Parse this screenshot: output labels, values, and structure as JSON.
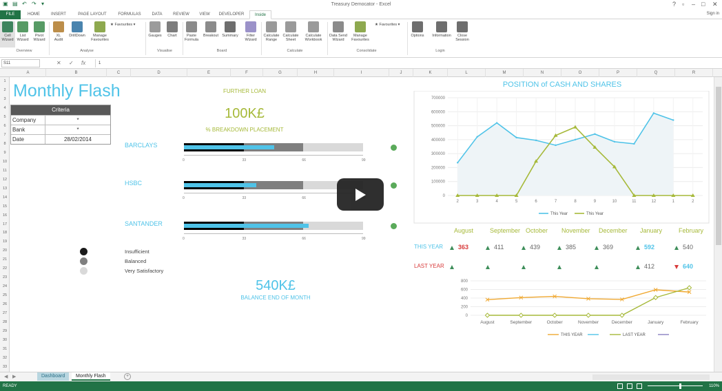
{
  "app": {
    "title": "Treasury Democator - Excel"
  },
  "tabs": [
    {
      "label": "FILE"
    },
    {
      "label": "HOME"
    },
    {
      "label": "INSERT"
    },
    {
      "label": "PAGE LAYOUT"
    },
    {
      "label": "FORMULAS"
    },
    {
      "label": "DATA"
    },
    {
      "label": "REVIEW"
    },
    {
      "label": "VIEW"
    },
    {
      "label": "DEVELOPER"
    },
    {
      "label": "Inside"
    }
  ],
  "signin": "Sign in",
  "ribbon": {
    "buttons": [
      {
        "label": "Cell\nWizard"
      },
      {
        "label": "List\nWizard"
      },
      {
        "label": "Pivot\nWizard"
      },
      {
        "label": "XL\nAudit"
      },
      {
        "label": "DrillDown"
      },
      {
        "label": "Manage\nFavourites"
      },
      {
        "label": "Gauges"
      },
      {
        "label": "Chart"
      },
      {
        "label": "Paste\nFormula"
      },
      {
        "label": "Breakout"
      },
      {
        "label": "Summary"
      },
      {
        "label": "Filter\nWizard"
      },
      {
        "label": "Calculate\nRange"
      },
      {
        "label": "Calculate\nSheet"
      },
      {
        "label": "Calculate\nWorkbook"
      },
      {
        "label": "Data Send\nWizard"
      },
      {
        "label": "Manage\nFavourites"
      },
      {
        "label": "Options"
      },
      {
        "label": "Information"
      },
      {
        "label": "Close\nSession"
      }
    ],
    "favourites_label": "Favourites",
    "groups": [
      "Overview",
      "Analyse",
      "Visualise",
      "Board",
      "Calculate",
      "Consolidate",
      "Login"
    ]
  },
  "formula_bar": {
    "name_box": "S11",
    "value": "1"
  },
  "columns": [
    "A",
    "B",
    "C",
    "D",
    "E",
    "F",
    "G",
    "H",
    "I",
    "J",
    "K",
    "L",
    "M",
    "N",
    "O",
    "P",
    "Q",
    "R"
  ],
  "rows": [
    "1",
    "2",
    "3",
    "4",
    "5",
    "6",
    "7",
    "8",
    "9",
    "10",
    "11",
    "12",
    "13",
    "14",
    "15",
    "16",
    "17",
    "18",
    "19",
    "20",
    "21",
    "22",
    "23",
    "24",
    "25",
    "26",
    "27",
    "28",
    "29",
    "30",
    "31",
    "32",
    "33"
  ],
  "dashboard": {
    "title": "Monthly Flash",
    "criteria": {
      "header": "Criteria",
      "rows": [
        {
          "key": "Company",
          "value": "*"
        },
        {
          "key": "Bank",
          "value": "*"
        },
        {
          "key": "Date",
          "value": "28/02/2014"
        }
      ]
    },
    "further_loan_label": "FURTHER LOAN",
    "further_loan_value": "100K£",
    "breakdown_label": "% BREAKDOWN PLACEMENT",
    "banks": [
      {
        "name": "BARCLAYS",
        "black": 33,
        "blue": 50,
        "mid": 66,
        "track": 99
      },
      {
        "name": "HSBC",
        "black": 33,
        "blue": 40,
        "mid": 66,
        "track": 99
      },
      {
        "name": "SANTANDER",
        "black": 33,
        "blue": 69,
        "mid": 66,
        "track": 99
      }
    ],
    "bullet_ticks": [
      "0",
      "33",
      "66",
      "99"
    ],
    "status_color": "#5aaa5a",
    "legend": [
      {
        "label": "Insufficient",
        "color": "#1a1a1a"
      },
      {
        "label": "Balanced",
        "color": "#7f7f7f"
      },
      {
        "label": "Very Satisfactory",
        "color": "#d9d9d9"
      }
    ],
    "balance_value": "540K£",
    "balance_label": "BALANCE END OF MONTH"
  },
  "chart_data": [
    {
      "type": "line",
      "title": "POSITION of CASH AND SHARES",
      "categories": [
        "2",
        "3",
        "4",
        "5",
        "6",
        "7",
        "8",
        "9",
        "10",
        "11",
        "12",
        "1",
        "2"
      ],
      "ylim": [
        0,
        700000
      ],
      "yticks": [
        "0",
        "100000",
        "200000",
        "300000",
        "400000",
        "500000",
        "600000",
        "700000"
      ],
      "grid": true,
      "legend": "bottom",
      "series": [
        {
          "name": "This Year",
          "color": "#4fc3e8",
          "values": [
            235000,
            420000,
            520000,
            415000,
            395000,
            360000,
            400000,
            440000,
            385000,
            370000,
            590000,
            540000,
            null
          ]
        },
        {
          "name": "This Year",
          "color": "#a6b939",
          "values": [
            0,
            0,
            0,
            0,
            245000,
            430000,
            490000,
            345000,
            205000,
            0,
            0,
            0,
            0
          ]
        }
      ]
    },
    {
      "type": "line",
      "categories": [
        "August",
        "September",
        "October",
        "November",
        "December",
        "January",
        "February"
      ],
      "ylim": [
        0,
        800
      ],
      "yticks": [
        "0",
        "200",
        "400",
        "600",
        "800"
      ],
      "grid": true,
      "legend": "bottom",
      "series": [
        {
          "name": "THIS YEAR",
          "color": "#f0a830",
          "values": [
            363,
            411,
            439,
            385,
            369,
            592,
            540
          ]
        },
        {
          "name": "LAST YEAR",
          "color": "#a6b939",
          "values": [
            0,
            0,
            0,
            0,
            0,
            412,
            640
          ]
        }
      ],
      "legend_extra_colors": [
        "#4fc3e8",
        "#8a7fc0"
      ]
    }
  ],
  "months_table": {
    "months": [
      "August",
      "September",
      "October",
      "November",
      "December",
      "January",
      "February"
    ],
    "this_year_label": "THIS YEAR",
    "last_year_label": "LAST YEAR",
    "this_year": [
      "363",
      "411",
      "439",
      "385",
      "369",
      "592",
      "540"
    ],
    "last_year": [
      "",
      "",
      "",
      "",
      "",
      "412",
      "640"
    ]
  },
  "sheet_tabs": [
    {
      "label": "Dashboard"
    },
    {
      "label": "Monthly Flash"
    }
  ],
  "status": {
    "ready": "READY",
    "zoom": "110%"
  }
}
